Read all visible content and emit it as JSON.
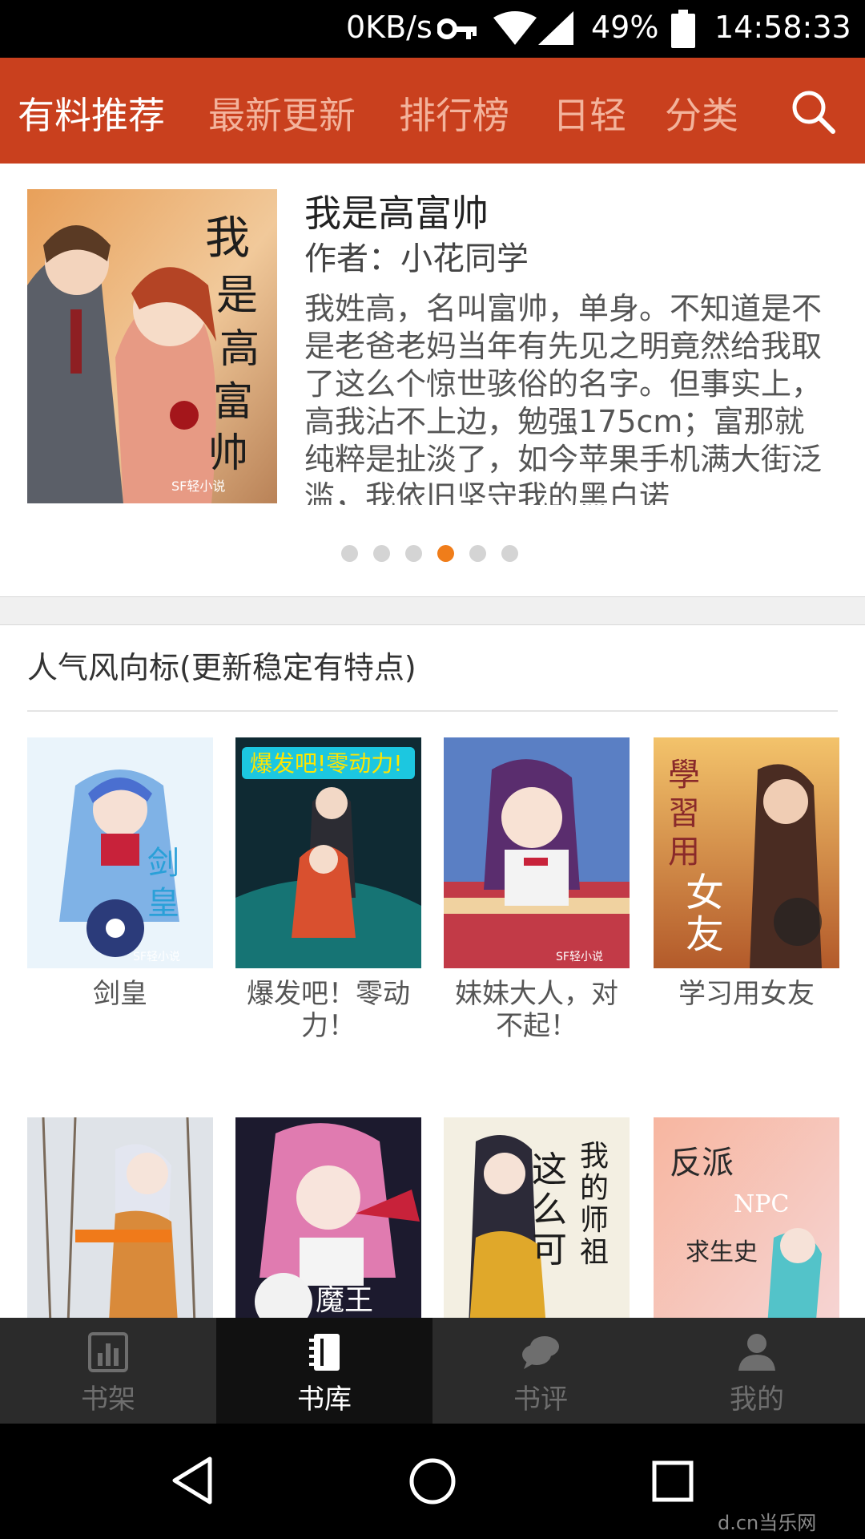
{
  "status_bar": {
    "net_speed": "0KB/s",
    "battery": "49%",
    "time": "14:58:33"
  },
  "top_nav": {
    "tabs": [
      {
        "label": "有料推荐",
        "active": true
      },
      {
        "label": "最新更新",
        "active": false
      },
      {
        "label": "排行榜",
        "active": false
      },
      {
        "label": "日轻",
        "active": false
      },
      {
        "label": "分类",
        "active": false
      }
    ],
    "search_icon": "search-icon"
  },
  "featured": {
    "title": "我是高富帅",
    "author": "作者：小花同学",
    "description": "我姓高，名叫富帅，单身。不知道是不是老爸老妈当年有先见之明竟然给我取了这么个惊世骇俗的名字。但事实上，高我沾不上边，勉强175cm；富那就纯粹是扯淡了，如今苹果手机满大街泛滥，我依旧坚守我的黑白诺",
    "carousel": {
      "count": 6,
      "active_index": 3
    }
  },
  "section": {
    "title": "人气风向标(更新稳定有特点)",
    "books": [
      {
        "title": "剑皇"
      },
      {
        "title": "爆发吧！零动力！"
      },
      {
        "title": "妹妹大人，对不起！"
      },
      {
        "title": "学习用女友"
      },
      {
        "title": ""
      },
      {
        "title": ""
      },
      {
        "title": ""
      },
      {
        "title": ""
      }
    ]
  },
  "bottom_tabs": [
    {
      "label": "书架",
      "icon": "bar-chart-icon",
      "active": false
    },
    {
      "label": "书库",
      "icon": "notebook-icon",
      "active": true
    },
    {
      "label": "书评",
      "icon": "chat-bubble-icon",
      "active": false
    },
    {
      "label": "我的",
      "icon": "person-icon",
      "active": false
    }
  ],
  "system_nav": {
    "buttons": [
      "back-icon",
      "home-icon",
      "recents-icon"
    ]
  },
  "watermark": "d.cn当乐网",
  "colors": {
    "accent": "#c9401e",
    "dot_active": "#f07d1a",
    "tab_bar_bg": "#2b2b2b"
  }
}
